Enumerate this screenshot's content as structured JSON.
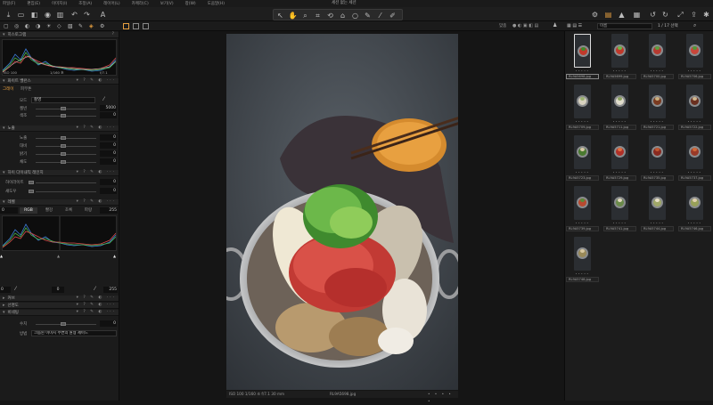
{
  "menu": [
    "파일(F)",
    "편집(E)",
    "이미지(I)",
    "조정(A)",
    "레이어(L)",
    "카메라(C)",
    "보기(V)",
    "창(W)",
    "도움말(H)"
  ],
  "window_title": "세션 없는 세션",
  "left": {
    "histogram_section": "히스토그램",
    "histogram_info": [
      "ISO 100",
      "1/160 초",
      "f/7.1"
    ],
    "wb_section": "화이트 밸런스",
    "wb_tabs": [
      "그레이",
      "피부톤"
    ],
    "wb_mode_label": "모드",
    "wb_mode_value": "촬영",
    "wb_rows": [
      {
        "label": "켈빈",
        "value": "5000"
      },
      {
        "label": "색조",
        "value": "0"
      }
    ],
    "exposure_section": "노출",
    "exposure_rows": [
      {
        "label": "노출",
        "value": "0"
      },
      {
        "label": "대비",
        "value": "0"
      },
      {
        "label": "밝기",
        "value": "0"
      },
      {
        "label": "채도",
        "value": "0"
      }
    ],
    "hdr_section": "하이 다이내믹 레인지",
    "hdr_rows": [
      {
        "label": "하이라이트",
        "value": "0"
      },
      {
        "label": "섀도우",
        "value": "0"
      }
    ],
    "levels_section": "레벨",
    "levels_tabs": [
      "RGB",
      "빨강",
      "초록",
      "파랑"
    ],
    "levels_left": "0",
    "levels_right": "255",
    "levels_in_left": "0",
    "levels_in_mid": "0",
    "levels_in_right": "255",
    "curve_section": "커브",
    "clarity_section": "선명도",
    "vignette_section": "비네팅",
    "vignette_amount_label": "수치",
    "vignette_amount_value": "0",
    "vignette_method_label": "방법",
    "vignette_method_value": "크롭된 이미지 주변의 원형 세이드"
  },
  "viewer": {
    "caption_left": "ISO 100  1/160 초  f/7.1  30 mm",
    "caption_center": "RL9A5698.jpg"
  },
  "right": {
    "filter_label": "이름",
    "count_label": "1 / 17 선택",
    "thumbnails": [
      {
        "name": "RL9A5698.jpg",
        "selected": true
      },
      {
        "name": "RL9A5699.jpg"
      },
      {
        "name": "RL9A5700.jpg"
      },
      {
        "name": "RL9A5706.jpg"
      },
      {
        "name": "RL9A5709.jpg"
      },
      {
        "name": "RL9A5711.jpg"
      },
      {
        "name": "RL9A5721.jpg"
      },
      {
        "name": "RL9A5722.jpg"
      },
      {
        "name": "RL9A5723.jpg"
      },
      {
        "name": "RL9A5729.jpg"
      },
      {
        "name": "RL9A5735.jpg"
      },
      {
        "name": "RL9A5737.jpg"
      },
      {
        "name": "RL9A5739.jpg"
      },
      {
        "name": "RL9A5741.jpg"
      },
      {
        "name": "RL9A5744.jpg"
      },
      {
        "name": "RL9A5746.jpg"
      },
      {
        "name": "RL9A5748.jpg"
      }
    ]
  },
  "colors": {
    "accent": "#e8a040",
    "panel": "#1b1b1b",
    "highlight": "#c0392b"
  }
}
